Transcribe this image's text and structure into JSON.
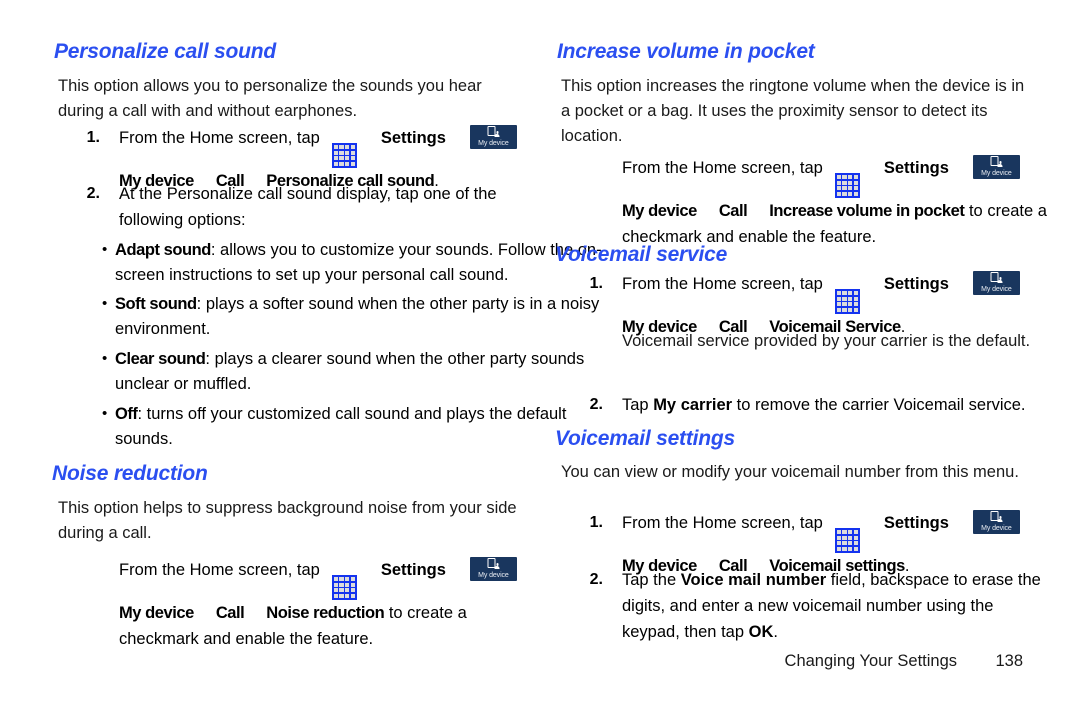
{
  "document": {
    "footer_title": "Changing Your Settings",
    "page_number": "138"
  },
  "colors": {
    "heading_blue": "#2b4ff0",
    "apps_icon_blue": "#1433ef",
    "mydevice_navy": "#19365e",
    "body_text": "#1a1a1a"
  },
  "icons": {
    "apps_grid": "apps-grid-icon",
    "my_device": "my-device-tab-icon",
    "my_device_label": "My device"
  },
  "left_column": {
    "personalize_call_sound": {
      "heading": "Personalize call sound",
      "intro": "This option allows you to personalize the sounds you hear during a call with and without earphones.",
      "step1": {
        "number": "1.",
        "lead": "From the Home screen, tap",
        "settings": "Settings",
        "nav1": "My device",
        "nav2": "Call",
        "nav3": "Personalize call sound",
        "trailing": "."
      },
      "step2": {
        "number": "2.",
        "text": "At the Personalize call sound display, tap one of the following options:"
      },
      "options": [
        {
          "term": "Adapt sound",
          "desc": ": allows you to customize your sounds. Follow the on-screen instructions to set up your personal call sound."
        },
        {
          "term": "Soft sound",
          "desc": ": plays a softer sound when the other party is in a noisy environment."
        },
        {
          "term": "Clear sound",
          "desc": ": plays a clearer sound when the other party sounds unclear or muffled."
        },
        {
          "term": "Off",
          "desc": ": turns off your customized call sound and plays the default sounds."
        }
      ]
    },
    "noise_reduction": {
      "heading": "Noise reduction",
      "intro": "This option helps to suppress background noise from your side during a call.",
      "step": {
        "lead": "From the Home screen, tap",
        "settings": "Settings",
        "nav1": "My device",
        "nav2": "Call",
        "nav3": "Noise reduction",
        "trailing": " to create a checkmark and enable the feature."
      }
    }
  },
  "right_column": {
    "increase_volume_in_pocket": {
      "heading": "Increase volume in pocket",
      "intro": "This option increases the ringtone volume when the device is in a pocket or a bag. It uses the proximity sensor to detect its location.",
      "step": {
        "lead": "From the Home screen, tap",
        "settings": "Settings",
        "nav1": "My device",
        "nav2": "Call",
        "nav3": "Increase volume in pocket",
        "trailing": " to create a checkmark and enable the feature."
      }
    },
    "voicemail_service": {
      "heading": "Voicemail service",
      "step1": {
        "number": "1.",
        "lead": "From the Home screen, tap",
        "settings": "Settings",
        "nav1": "My device",
        "nav2": "Call",
        "nav3": "Voicemail Service",
        "trailing": ".",
        "note": "Voicemail service provided by your carrier is the default."
      },
      "step2": {
        "number": "2.",
        "pre": "Tap ",
        "term": "My carrier",
        "post": " to remove the carrier Voicemail service."
      }
    },
    "voicemail_settings": {
      "heading": "Voicemail settings",
      "intro": "You can view or modify your voicemail number from this menu.",
      "step1": {
        "number": "1.",
        "lead": "From the Home screen, tap",
        "settings": "Settings",
        "nav1": "My device",
        "nav2": "Call",
        "nav3": "Voicemail settings",
        "trailing": "."
      },
      "step2": {
        "number": "2.",
        "pre": "Tap the ",
        "term": "Voice mail number",
        "mid": " field, backspace to erase the digits, and enter a new voicemail number using the keypad, then tap ",
        "term2": "OK",
        "post": "."
      }
    }
  }
}
